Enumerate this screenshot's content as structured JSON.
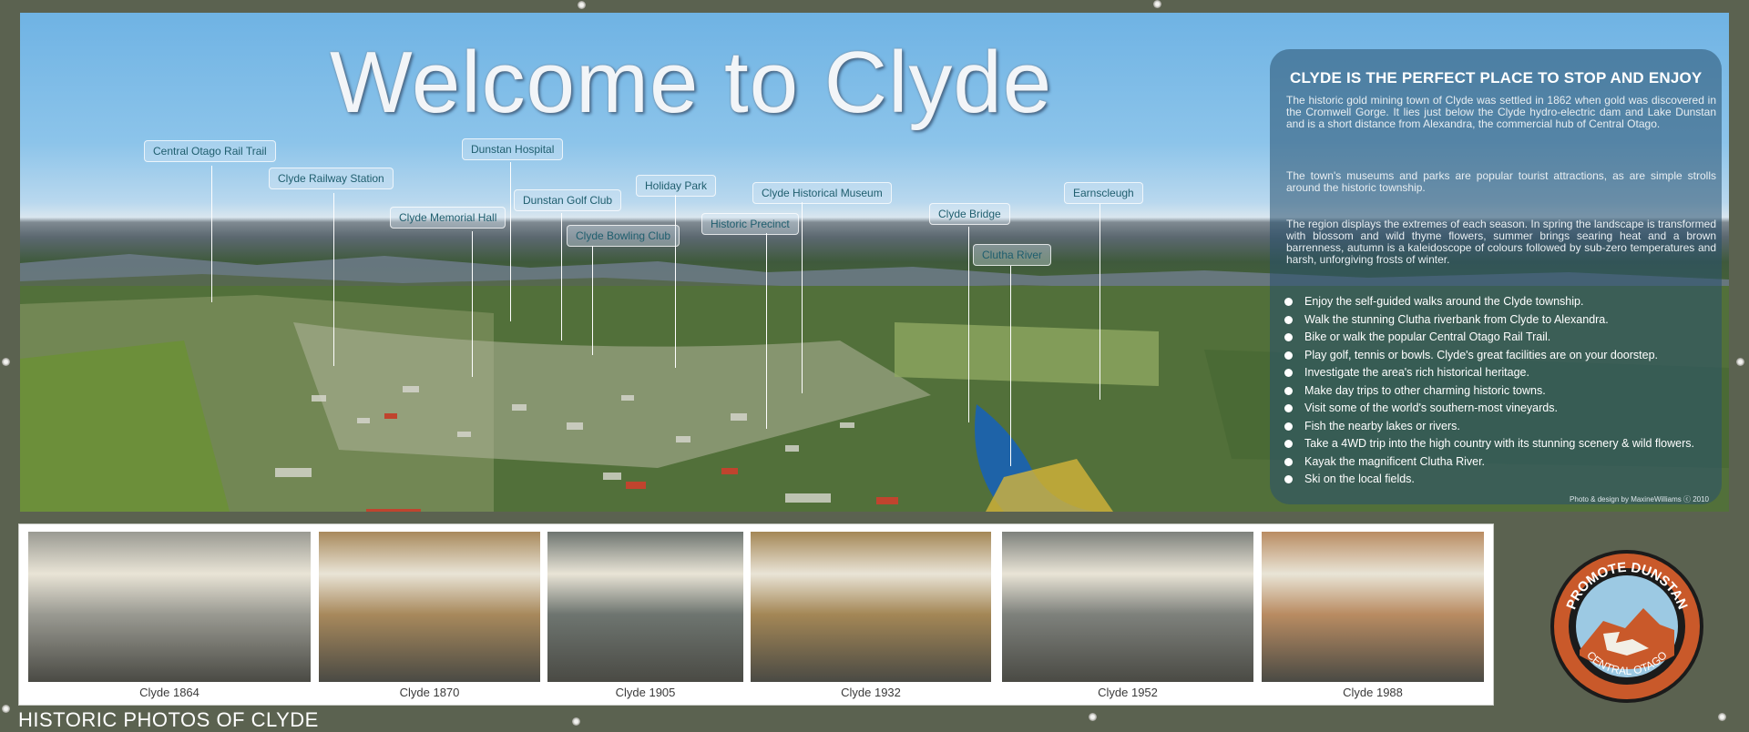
{
  "title": "Welcome to  Clyde",
  "landmarks": [
    {
      "label": "Central Otago Rail Trail"
    },
    {
      "label": "Clyde Railway Station"
    },
    {
      "label": "Clyde Memorial Hall"
    },
    {
      "label": "Dunstan Hospital"
    },
    {
      "label": "Dunstan Golf Club"
    },
    {
      "label": "Clyde Bowling Club"
    },
    {
      "label": "Holiday Park"
    },
    {
      "label": "Historic Precinct"
    },
    {
      "label": "Clyde Historical Museum"
    },
    {
      "label": "Clyde Bridge"
    },
    {
      "label": "Clutha River"
    },
    {
      "label": "Earnscleugh"
    }
  ],
  "info": {
    "heading": "CLYDE IS THE PERFECT PLACE TO  STOP  AND  ENJOY",
    "paragraphs": [
      "The historic gold mining town of Clyde was settled in 1862 when gold was discovered in the Cromwell Gorge.  It lies just below the Clyde hydro-electric dam and Lake Dunstan and is a short distance from Alexandra, the commercial hub of Central Otago.",
      "The town's museums and parks are popular tourist attractions, as are simple strolls around the historic township.",
      "The region displays the extremes of each season. In spring the landscape is transformed with blossom and wild thyme flowers, summer brings searing heat and a brown barrenness, autumn is a kaleidoscope of colours followed by sub-zero temperatures and harsh, unforgiving frosts of winter."
    ],
    "bullets": [
      "Enjoy the self-guided walks around the Clyde township.",
      "Walk the stunning Clutha riverbank from Clyde to Alexandra.",
      "Bike or walk the popular Central Otago Rail Trail.",
      "Play golf, tennis or bowls. Clyde's great facilities are on your doorstep.",
      "Investigate the area's rich historical heritage.",
      "Make day trips to other charming historic towns.",
      "Visit some of the world's southern-most vineyards.",
      "Fish the nearby lakes or rivers.",
      "Take a 4WD trip into the high country with its stunning scenery & wild flowers.",
      "Kayak the magnificent Clutha River.",
      "Ski on the local fields."
    ],
    "credit": "Photo & design by MaxineWilliams ⓒ 2010"
  },
  "photos": [
    {
      "caption": "Clyde 1864",
      "tone": "#9a9a92"
    },
    {
      "caption": "Clyde 1870",
      "tone": "#a8895c"
    },
    {
      "caption": "Clyde 1905",
      "tone": "#6e7570"
    },
    {
      "caption": "Clyde 1932",
      "tone": "#a48756"
    },
    {
      "caption": "Clyde 1952",
      "tone": "#7e817c"
    },
    {
      "caption": "Clyde 1988",
      "tone": "#b98c62"
    }
  ],
  "historic_heading": "HISTORIC PHOTOS OF CLYDE",
  "logo": {
    "top_text": "PROMOTE DUNSTAN",
    "bottom_text": "CENTRAL OTAGO"
  }
}
